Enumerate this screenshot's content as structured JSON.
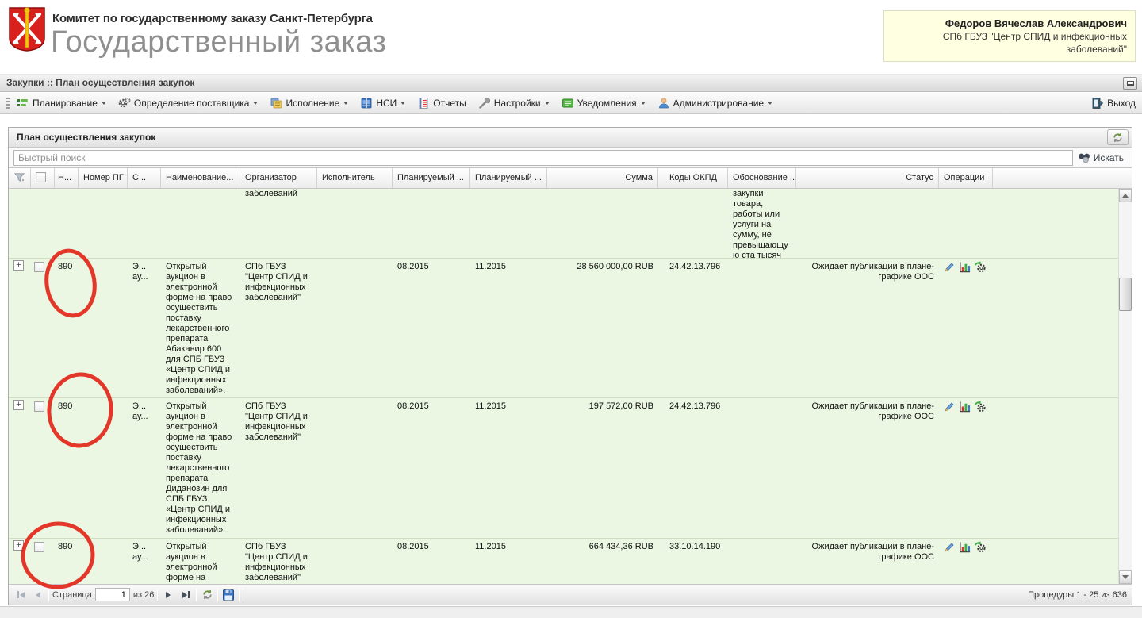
{
  "header": {
    "committee": "Комитет по государственному заказу Санкт-Петербурга",
    "app_title": "Государственный заказ",
    "user": {
      "name": "Федоров Вячеслав Александрович",
      "organization": "СПб ГБУЗ \"Центр СПИД и инфекционных заболеваний\""
    }
  },
  "breadcrumb": "Закупки :: План осуществления закупок",
  "menu": {
    "items": [
      "Планирование",
      "Определение поставщика",
      "Исполнение",
      "НСИ",
      "Отчеты",
      "Настройки",
      "Уведомления",
      "Администрирование"
    ],
    "exit": "Выход"
  },
  "panel": {
    "title": "План осуществления закупок",
    "search": {
      "placeholder": "Быстрый поиск",
      "button": "Искать"
    }
  },
  "grid": {
    "columns": {
      "num": "Н...",
      "pg": "Номер ПГ",
      "type": "С...",
      "name": "Наименование...",
      "organizer": "Организатор",
      "executor": "Исполнитель",
      "planned1": "Планируемый ...",
      "planned2": "Планируемый ...",
      "sum": "Сумма",
      "okpd": "Коды ОКПД",
      "justification": "Обоснование ...",
      "status": "Статус",
      "operations": "Операции"
    },
    "partial_row": {
      "organizer_tail": "заболеваний",
      "justification": "закупки товара, работы или услуги на сумму, не превышающую ста тысяч рублей."
    },
    "rows": [
      {
        "num": "890",
        "type": "Э... ау...",
        "name": "Открытый аукцион в электронной форме на право осуществить поставку лекарственного препарата Абакавир 600 для СПБ ГБУЗ «Центр СПИД и инфекционных заболеваний».",
        "organizer": "СПб ГБУЗ \"Центр СПИД и инфекционных заболеваний\"",
        "planned1": "08.2015",
        "planned2": "11.2015",
        "sum": "28 560 000,00 RUB",
        "okpd": "24.42.13.796",
        "status": "Ожидает публикации в плане-графике ООС"
      },
      {
        "num": "890",
        "type": "Э... ау...",
        "name": "Открытый аукцион в электронной форме на право осуществить поставку лекарственного препарата Диданозин для СПБ ГБУЗ «Центр СПИД и инфекционных заболеваний».",
        "organizer": "СПб ГБУЗ \"Центр СПИД и инфекционных заболеваний\"",
        "planned1": "08.2015",
        "planned2": "11.2015",
        "sum": "197 572,00 RUB",
        "okpd": "24.42.13.796",
        "status": "Ожидает публикации в плане-графике ООС"
      },
      {
        "num": "890",
        "type": "Э... ау...",
        "name": "Открытый аукцион в электронной форме на",
        "organizer": "СПб ГБУЗ \"Центр СПИД и инфекционных заболеваний\"",
        "planned1": "08.2015",
        "planned2": "11.2015",
        "sum": "664 434,36 RUB",
        "okpd": "33.10.14.190",
        "status": "Ожидает публикации в плане-графике ООС"
      }
    ]
  },
  "pager": {
    "page_label": "Страница",
    "page_value": "1",
    "pages_total": "из 26",
    "summary": "Процедуры 1 - 25 из 636"
  },
  "colors": {
    "row_green": "#EBF7E2",
    "annotation_red": "#E2261A",
    "user_box": "#FFFFE1",
    "accent_blue": "#3B76C4"
  }
}
